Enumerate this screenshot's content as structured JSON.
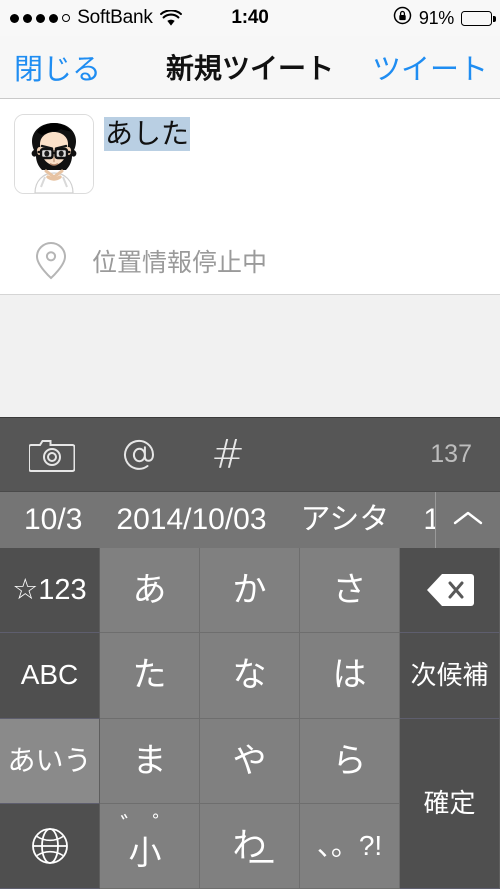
{
  "status_bar": {
    "signal_dots_filled": 4,
    "signal_dots_total": 5,
    "carrier": "SoftBank",
    "wifi_icon": "wifi-icon",
    "time": "1:40",
    "rotation_lock_icon": "rotation-lock-icon",
    "battery_percent": "91%",
    "battery_level": 91
  },
  "nav_bar": {
    "close_label": "閉じる",
    "title": "新規ツイート",
    "tweet_label": "ツイート",
    "accent_color": "#1f8df2"
  },
  "compose": {
    "avatar_name": "user-avatar",
    "tweet_text": "あした",
    "text_is_marked": true,
    "marked_color": "#b9cfe3"
  },
  "location": {
    "icon": "map-pin-icon",
    "label": "位置情報停止中"
  },
  "tweet_toolbar": {
    "background": "#565656",
    "camera_icon": "camera-icon",
    "mention_icon": "at-icon",
    "hashtag_icon": "hashtag-icon",
    "hashtag_glyph": "#",
    "char_count": "137"
  },
  "prediction_bar": {
    "background": "#757575",
    "candidates": [
      "10/3",
      "2014/10/03",
      "アシタ",
      "1"
    ],
    "expand_icon": "chevron-up-icon"
  },
  "keyboard": {
    "background": "#4f4f4f",
    "kana_key_color": "#808080",
    "rows": [
      {
        "left": {
          "name": "key-symbols",
          "label": "☆123",
          "type": "fn"
        },
        "keys": [
          {
            "name": "key-a",
            "label": "あ"
          },
          {
            "name": "key-ka",
            "label": "か"
          },
          {
            "name": "key-sa",
            "label": "さ"
          }
        ],
        "right": {
          "name": "key-backspace",
          "label": "delete-icon",
          "type": "fn"
        }
      },
      {
        "left": {
          "name": "key-abc",
          "label": "ABC",
          "type": "fn"
        },
        "keys": [
          {
            "name": "key-ta",
            "label": "た"
          },
          {
            "name": "key-na",
            "label": "な"
          },
          {
            "name": "key-ha",
            "label": "は"
          }
        ],
        "right": {
          "name": "key-next-candidate",
          "label": "次候補",
          "type": "fn"
        }
      },
      {
        "left": {
          "name": "key-kana-mode",
          "label": "あいう",
          "type": "fn",
          "active": true
        },
        "keys": [
          {
            "name": "key-ma",
            "label": "ま"
          },
          {
            "name": "key-ya",
            "label": "や"
          },
          {
            "name": "key-ra",
            "label": "ら"
          }
        ],
        "right": {
          "name": "key-confirm",
          "label": "確定",
          "type": "fn",
          "tall": true
        }
      },
      {
        "left": {
          "name": "key-globe",
          "label": "globe-icon",
          "type": "fn"
        },
        "keys": [
          {
            "name": "key-small-dakuten",
            "label": "小゛゜",
            "parts": {
              "dakuten": "゛",
              "handakuten": "゜",
              "small": "小"
            }
          },
          {
            "name": "key-wa",
            "label": "わ_",
            "parts": {
              "main": "わ",
              "under": "ー"
            }
          },
          {
            "name": "key-punctuation",
            "label": "、。?!"
          }
        ],
        "right": null
      }
    ]
  }
}
